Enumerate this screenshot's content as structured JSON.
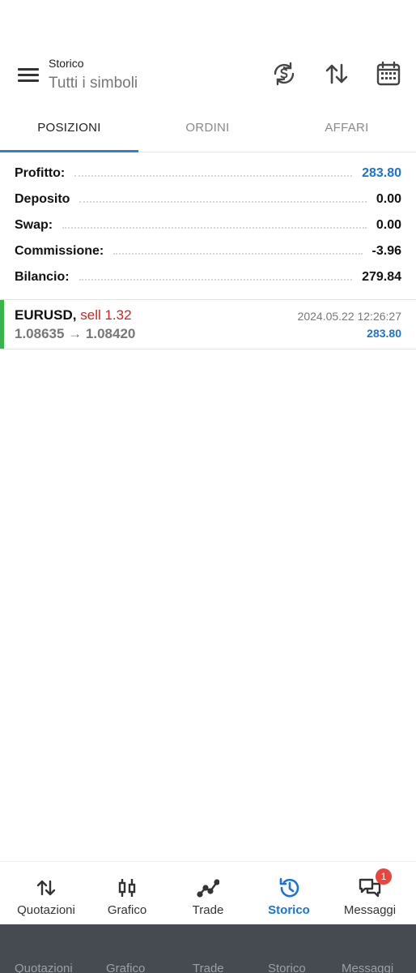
{
  "header": {
    "title": "Storico",
    "subtitle": "Tutti i simboli",
    "icons": [
      "menu-icon",
      "currency-exchange-icon",
      "sort-icon",
      "calendar-icon"
    ]
  },
  "tabs": [
    {
      "label": "POSIZIONI",
      "active": true
    },
    {
      "label": "ORDINI",
      "active": false
    },
    {
      "label": "AFFARI",
      "active": false
    }
  ],
  "summary": {
    "profit": {
      "label": "Profitto:",
      "value": "283.80"
    },
    "deposit": {
      "label": "Deposito",
      "value": "0.00"
    },
    "swap": {
      "label": "Swap:",
      "value": "0.00"
    },
    "commission": {
      "label": "Commissione:",
      "value": "-3.96"
    },
    "balance": {
      "label": "Bilancio:",
      "value": "279.84"
    }
  },
  "trades": [
    {
      "symbol": "EURUSD,",
      "type": "sell 1.32",
      "prices": "1.08635 → 1.08420",
      "datetime": "2024.05.22 12:26:27",
      "profit": "283.80"
    }
  ],
  "bottom_nav": [
    {
      "label": "Quotazioni",
      "icon": "quotes-icon"
    },
    {
      "label": "Grafico",
      "icon": "chart-icon"
    },
    {
      "label": "Trade",
      "icon": "trade-icon"
    },
    {
      "label": "Storico",
      "icon": "history-icon",
      "active": true
    },
    {
      "label": "Messaggi",
      "icon": "messages-icon",
      "badge": "1"
    }
  ],
  "colors": {
    "accent": "#1a73d9",
    "sell": "#d1231b",
    "position_bar": "#38b44a",
    "badge": "#e8453c",
    "system_bar": "#464b51"
  }
}
